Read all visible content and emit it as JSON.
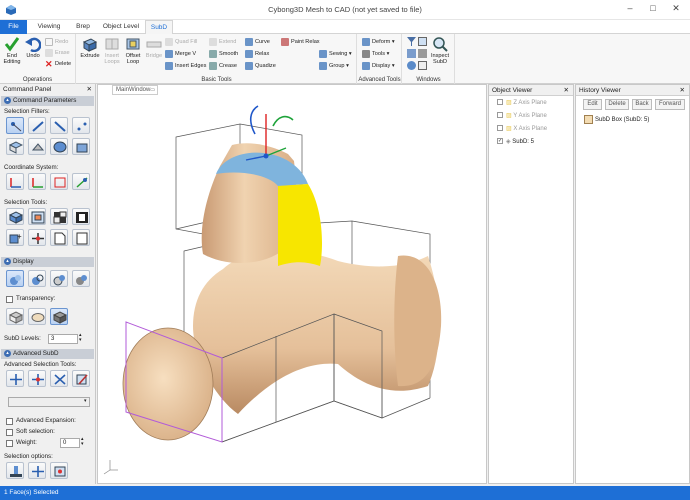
{
  "window": {
    "title": "Cybong3D Mesh to CAD  (not yet saved to file)"
  },
  "tabs": {
    "file": "File",
    "viewing": "Viewing",
    "brep": "Brep",
    "object_level": "Object Level",
    "subd": "SubD"
  },
  "ribbon": {
    "operations": {
      "end_editing": "End\nEditing",
      "undo": "Undo",
      "redo": "Redo",
      "erase": "Erase",
      "delete": "Delete",
      "group": "Operations"
    },
    "basic": {
      "extrude": "Extrude",
      "insert_loops": "Insert\nLoops",
      "offset_loop": "Offset\nLoop",
      "bridge": "Bridge",
      "quad_fill": "Quad Fill",
      "merge_v": "Merge V",
      "insert_edges": "Insert Edges",
      "extend": "Extend",
      "smooth": "Smooth",
      "crease": "Crease",
      "curve": "Curve",
      "relax": "Relax",
      "quadize": "Quadize",
      "paint_relax": "Paint Relax",
      "sewing": "Sewing",
      "group_menu": "Group",
      "group": "Basic Tools"
    },
    "advanced": {
      "deform": "Deform",
      "tools": "Tools",
      "display": "Display",
      "group": "Advanced Tools"
    },
    "windows": {
      "inspect": "Inspect\nSubD",
      "group": "Windows"
    }
  },
  "command_panel": {
    "title": "Command Panel",
    "section_params": "Command Parameters",
    "selection_filters": "Selection Filters:",
    "coordinate_system": "Coordinate System:",
    "selection_tools": "Selection Tools:",
    "display": "Display",
    "transparency": "Transparency:",
    "subd_levels_label": "SubD Levels:",
    "subd_levels_value": "3",
    "advanced_subd": "Advanced SubD",
    "adv_selection_tools": "Advanced Selection Tools:",
    "advanced_expansion": "Advanced Expansion:",
    "soft_selection": "Soft selection:",
    "weight_label": "Weight:",
    "weight_value": "0",
    "selection_options": "Selection options:"
  },
  "main_window": {
    "tab": "MainWindow"
  },
  "object_viewer": {
    "title": "Object Viewer",
    "items": [
      {
        "label": "Z Axis Plane",
        "checked": false
      },
      {
        "label": "Y Axis Plane",
        "checked": false
      },
      {
        "label": "X Axis Plane",
        "checked": false
      },
      {
        "label": "SubD: 5",
        "checked": true
      }
    ]
  },
  "history_viewer": {
    "title": "History Viewer",
    "edit": "Edit",
    "delete": "Delete",
    "back": "Back",
    "forward": "Forward",
    "item": "SubD Box (SubD: 5)"
  },
  "status": {
    "text": "1 Face(s) Selected"
  },
  "colors": {
    "accent": "#1e6fd6",
    "shape": "#efcfa8",
    "face_selected": "#f7e600",
    "top_face": "#7fb4dd",
    "bbox": "#555555",
    "bbox_selected": "#b25bd8"
  }
}
